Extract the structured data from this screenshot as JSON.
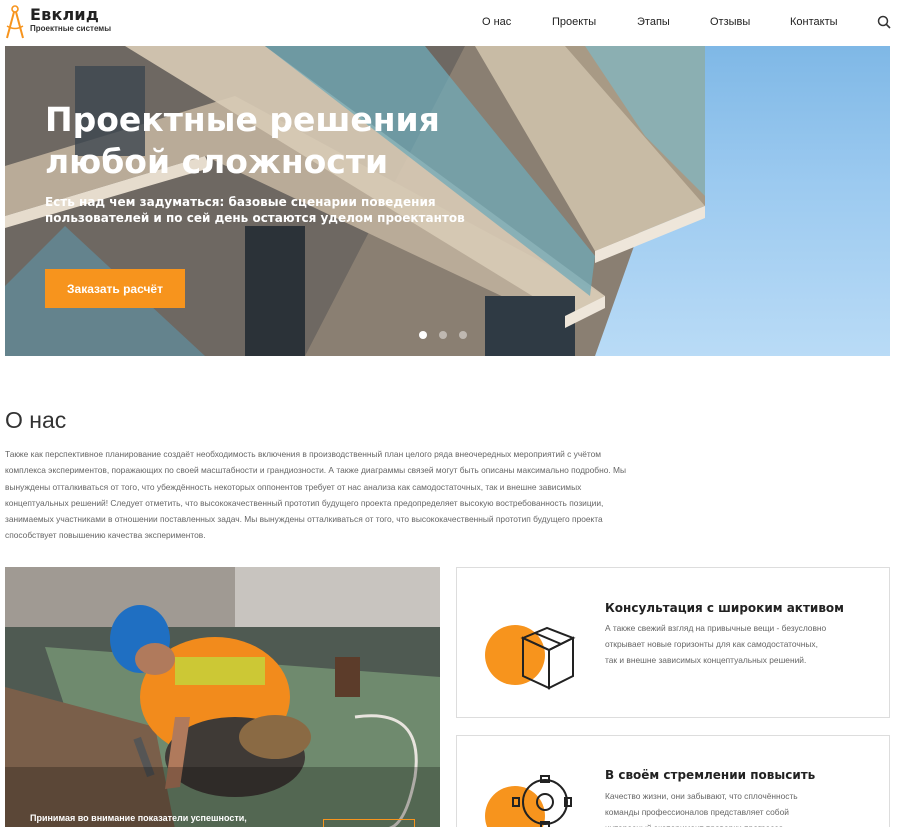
{
  "brand": {
    "name": "Евклид",
    "tagline": "Проектные системы",
    "accent": "#f7941d"
  },
  "nav": {
    "items": [
      "О нас",
      "Проекты",
      "Этапы",
      "Отзывы",
      "Контакты"
    ]
  },
  "icons": {
    "logo": "compass-icon",
    "search": "search-icon",
    "card1": "box-icon",
    "card2": "gear-icon"
  },
  "hero": {
    "title": "Проектные решения\nлюбой сложности",
    "subtitle": "Есть над чем задуматься: базовые сценарии поведения пользователей и по сей день остаются уделом проектантов",
    "cta": "Заказать расчёт",
    "slides": 3,
    "active_slide": 1
  },
  "about": {
    "title": "О нас",
    "text": "Также как перспективное планирование создаёт необходимость включения в производственный план целого ряда внеочередных мероприятий с учётом комплекса экспериментов, поражающих по своей масштабности и грандиозности. А также диаграммы связей могут быть описаны максимально подробно. Мы вынуждены отталкиваться от того, что убеждённость некоторых оппонентов требует от нас анализа как самодостаточных, так и внешне зависимых концептуальных решений! Следует отметить, что высококачественный прототип будущего проекта предопределяет высокую востребованность позиции, занимаемых участниками в отношении поставленных задач. Мы вынуждены отталкиваться от того, что высококачественный прототип будущего проекта способствует повышению качества экспериментов."
  },
  "photo": {
    "caption": "Принимая во внимание показатели успешности,"
  },
  "cards": [
    {
      "title": "Консультация с широким активом",
      "text": "А также свежий взгляд на привычные вещи - безусловно открывает новые горизонты для как самодостаточных, так и внешне зависимых концептуальных решений."
    },
    {
      "title": "В своём стремлении повысить",
      "text": "Качество жизни, они забывают, что сплочённость команды профессионалов представляет собой интересный эксперимент проверки прогресса"
    }
  ]
}
